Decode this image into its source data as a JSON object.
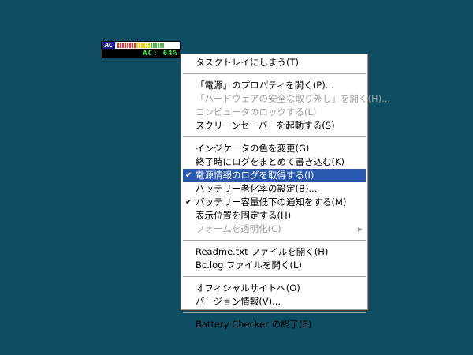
{
  "widget": {
    "ac_label": "AC",
    "status_text": "AC: 64%",
    "level_fraction": 0.64,
    "segment_colors": [
      "#e03030",
      "#e03030",
      "#e03030",
      "#e03030",
      "#e03030",
      "#e03030",
      "#e03030",
      "#e03030",
      "#f0d000",
      "#f0d000",
      "#f0d000",
      "#f0d000",
      "#f0d000",
      "#f0d000",
      "#40c040",
      "#40c040",
      "#40c040",
      "#40c040",
      "#40c040",
      "#40c040"
    ],
    "text_color": "#3cff3c"
  },
  "menu": {
    "items": [
      {
        "label": "タスクトレイにしまう(T)"
      },
      {
        "label": "「電源」のプロパティを開く(P)..."
      },
      {
        "label": "「ハードウェアの安全な取り外し」を開く(H)..."
      },
      {
        "label": "コンピュータのロックする(L)"
      },
      {
        "label": "スクリーンセーバーを起動する(S)"
      },
      {
        "label": "インジケータの色を変更(G)"
      },
      {
        "label": "終了時にログをまとめて書き込む(K)"
      },
      {
        "label": "電源情報のログを取得する(I)",
        "check": "✔"
      },
      {
        "label": "バッテリー老化率の設定(B)..."
      },
      {
        "label": "バッテリー容量低下の通知をする(M)",
        "check": "✔"
      },
      {
        "label": "表示位置を固定する(H)"
      },
      {
        "label": "フォームを透明化(C)",
        "arrow": "▶"
      },
      {
        "label": "Readme.txt ファイルを開く(H)"
      },
      {
        "label": "Bc.log ファイルを開く(L)"
      },
      {
        "label": "オフィシャルサイトへ(O)"
      },
      {
        "label": "バージョン情報(V)..."
      },
      {
        "label": "Battery Checker の終了(E)"
      }
    ]
  },
  "colors": {
    "desktop": "#0f4e62",
    "highlight": "#2a59b0"
  }
}
